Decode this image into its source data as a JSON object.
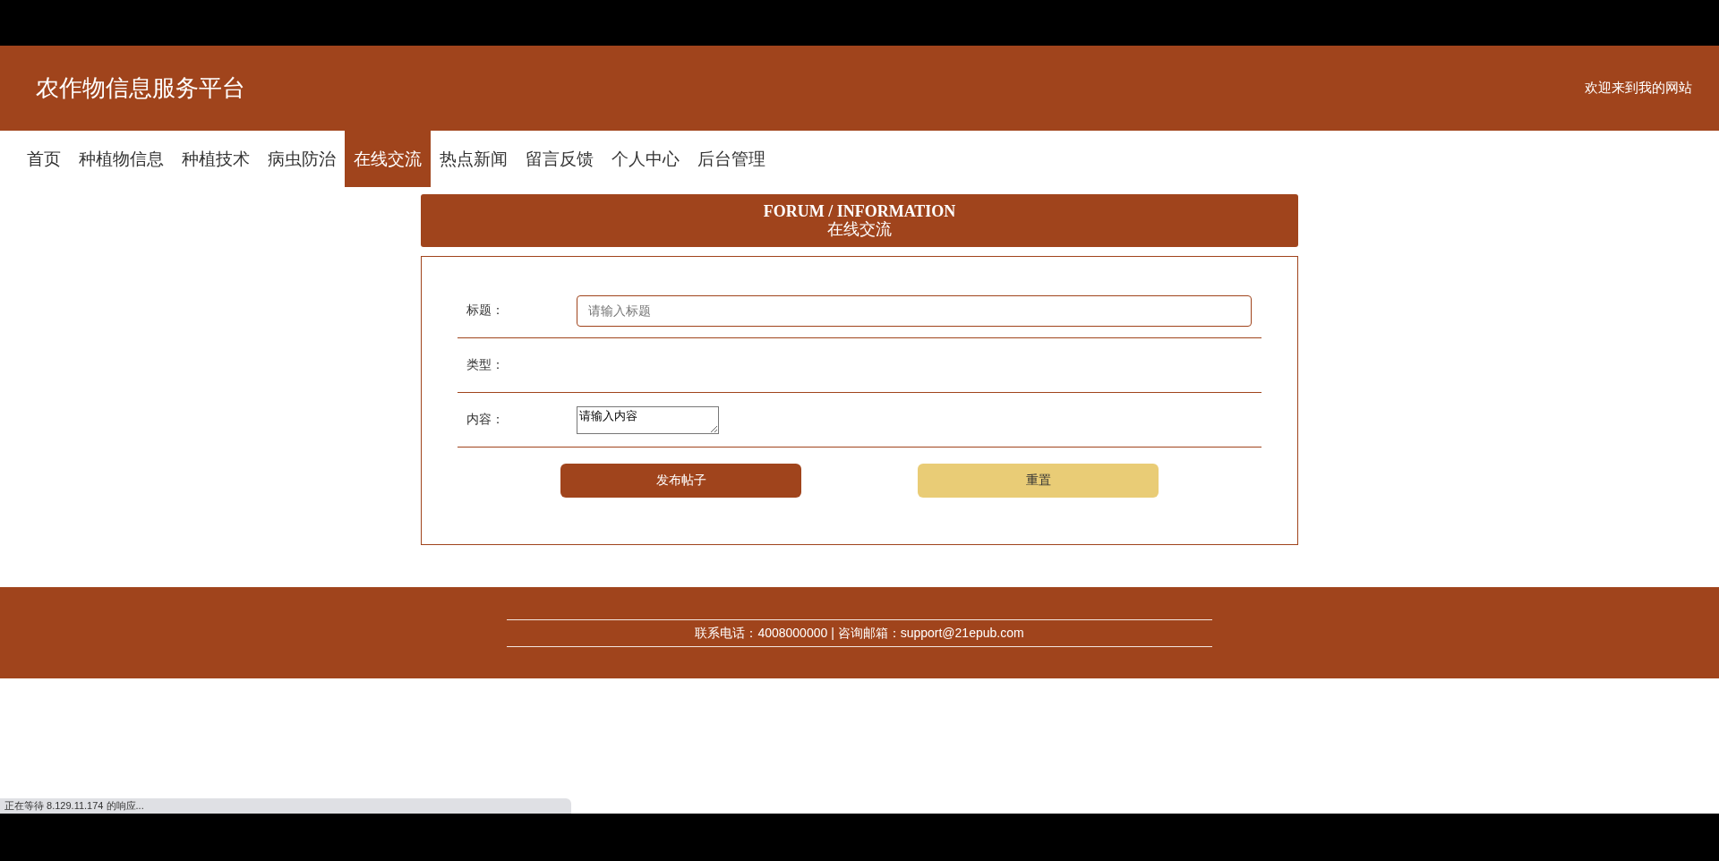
{
  "header": {
    "site_title": "农作物信息服务平台",
    "welcome": "欢迎来到我的网站"
  },
  "nav": [
    {
      "label": "首页",
      "selected": false
    },
    {
      "label": "种植物信息",
      "selected": false
    },
    {
      "label": "种植技术",
      "selected": false
    },
    {
      "label": "病虫防治",
      "selected": false
    },
    {
      "label": "在线交流",
      "selected": true
    },
    {
      "label": "热点新闻",
      "selected": false
    },
    {
      "label": "留言反馈",
      "selected": false
    },
    {
      "label": "个人中心",
      "selected": false
    },
    {
      "label": "后台管理",
      "selected": false
    }
  ],
  "section": {
    "title_en": "FORUM / INFORMATION",
    "title_cn": "在线交流"
  },
  "form": {
    "fields": [
      {
        "kind": "input",
        "label": "标题：",
        "placeholder": "请输入标题"
      },
      {
        "kind": "none",
        "label": "类型："
      },
      {
        "kind": "textarea",
        "label": "内容：",
        "placeholder": "请输入内容"
      }
    ],
    "buttons": [
      {
        "kind": "primary",
        "label": "发布帖子"
      },
      {
        "kind": "secondary",
        "label": "重置"
      }
    ]
  },
  "footer": {
    "contact": "联系电话：4008000000 | 咨询邮箱：support@21epub.com"
  },
  "status_bar": {
    "text": "正在等待 8.129.11.174 的响应..."
  }
}
